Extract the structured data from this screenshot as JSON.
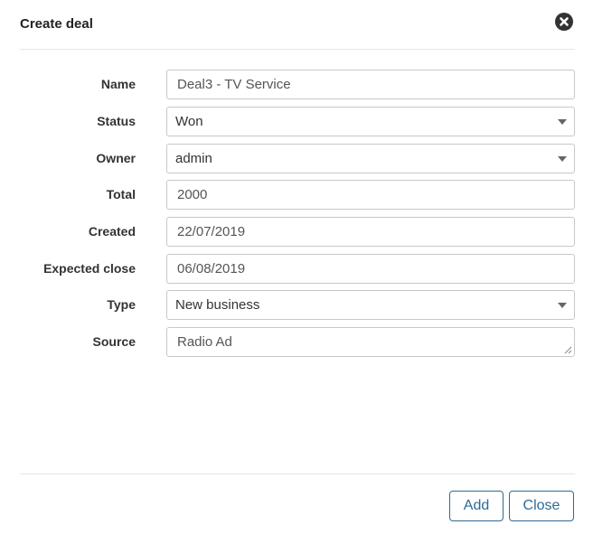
{
  "dialog": {
    "title": "Create deal",
    "close_icon": "close-circle-icon"
  },
  "form": {
    "name": {
      "label": "Name",
      "value": "Deal3 - TV Service"
    },
    "status": {
      "label": "Status",
      "value": "Won"
    },
    "owner": {
      "label": "Owner",
      "value": "admin"
    },
    "total": {
      "label": "Total",
      "value": "2000"
    },
    "created": {
      "label": "Created",
      "value": "22/07/2019"
    },
    "expected_close": {
      "label": "Expected close",
      "value": "06/08/2019"
    },
    "type": {
      "label": "Type",
      "value": "New business"
    },
    "source": {
      "label": "Source",
      "value": "Radio Ad"
    }
  },
  "footer": {
    "add_label": "Add",
    "close_label": "Close"
  },
  "colors": {
    "button_accent": "#2d6a96",
    "border": "#c8c8c8",
    "text": "#333333"
  }
}
